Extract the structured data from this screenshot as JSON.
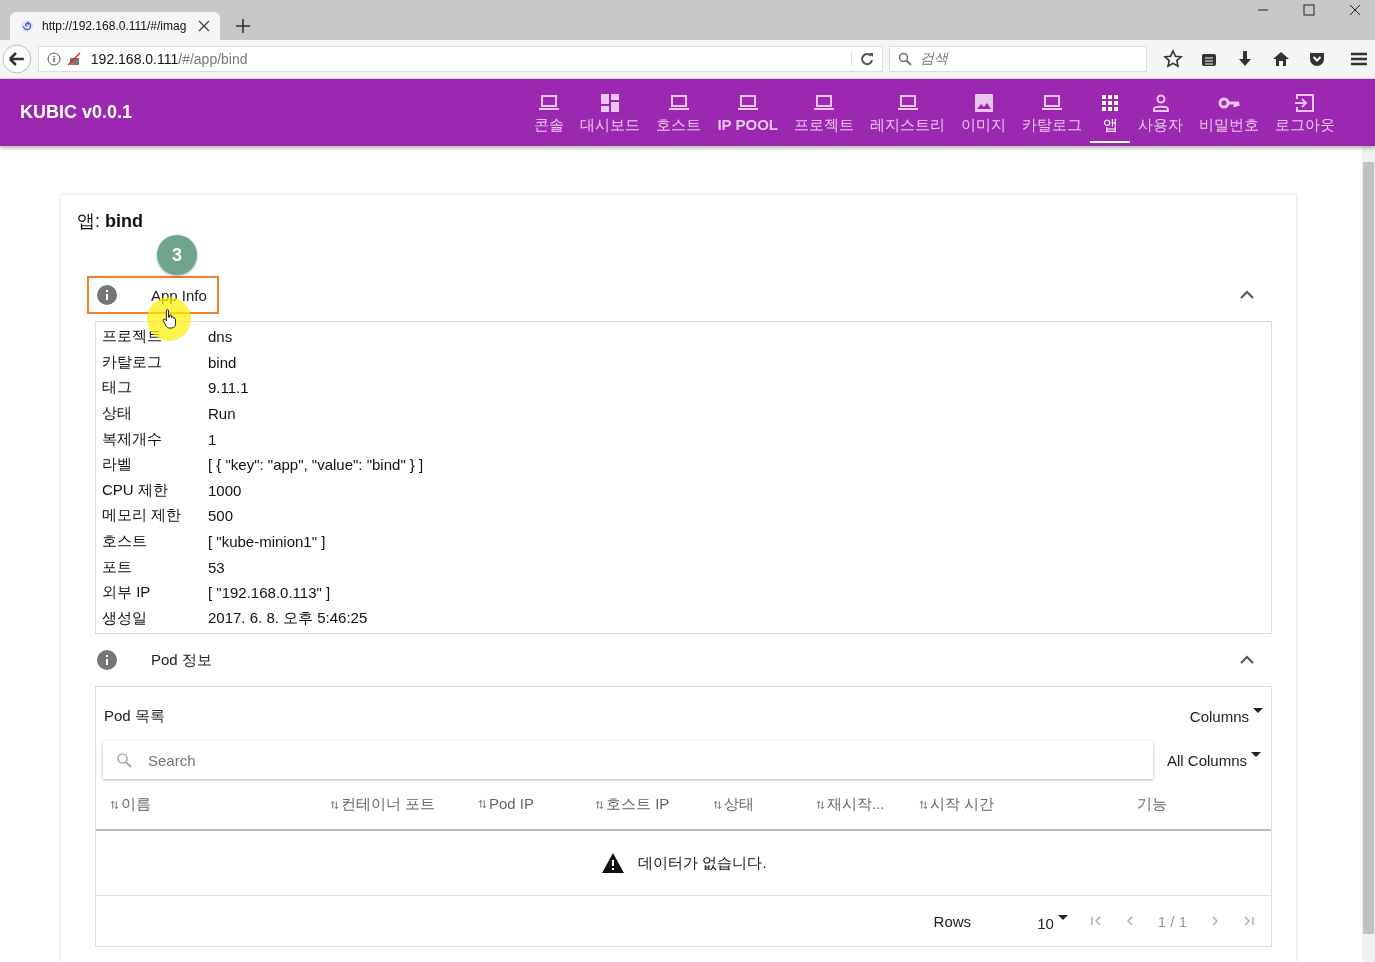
{
  "browser": {
    "tab_title": "http://192.168.0.111/#/imag",
    "url_host": "192.168.0.111",
    "url_path": "/#/app/bind",
    "search_placeholder": "검색"
  },
  "header": {
    "brand": "KUBIC v0.0.1",
    "nav": [
      {
        "label": "콘솔",
        "kind": "laptop",
        "selected": false
      },
      {
        "label": "대시보드",
        "kind": "dashboard",
        "selected": false
      },
      {
        "label": "호스트",
        "kind": "laptop",
        "selected": false
      },
      {
        "label": "IP POOL",
        "kind": "laptop",
        "selected": false
      },
      {
        "label": "프로젝트",
        "kind": "laptop",
        "selected": false
      },
      {
        "label": "레지스트리",
        "kind": "laptop",
        "selected": false
      },
      {
        "label": "이미지",
        "kind": "image",
        "selected": false
      },
      {
        "label": "카탈로그",
        "kind": "laptop",
        "selected": false
      },
      {
        "label": "앱",
        "kind": "apps",
        "selected": true
      },
      {
        "label": "사용자",
        "kind": "person",
        "selected": false
      },
      {
        "label": "비밀번호",
        "kind": "key",
        "selected": false
      },
      {
        "label": "로그아웃",
        "kind": "logout",
        "selected": false
      }
    ]
  },
  "page": {
    "title_prefix": "앱:",
    "title_name": "bind",
    "step_badge": "3",
    "app_info": {
      "title": "App Info",
      "expanded": true,
      "highlighted": true,
      "rows": [
        {
          "label": "프로젝트",
          "value": "dns"
        },
        {
          "label": "카탈로그",
          "value": "bind"
        },
        {
          "label": "태그",
          "value": "9.11.1"
        },
        {
          "label": "상태",
          "value": "Run"
        },
        {
          "label": "복제개수",
          "value": "1"
        },
        {
          "label": "라벨",
          "value": "[ { \"key\": \"app\", \"value\": \"bind\" } ]"
        },
        {
          "label": "CPU 제한",
          "value": "1000"
        },
        {
          "label": "메모리 제한",
          "value": "500"
        },
        {
          "label": "호스트",
          "value": "[ \"kube-minion1\" ]"
        },
        {
          "label": "포트",
          "value": "53"
        },
        {
          "label": "외부 IP",
          "value": "[ \"192.168.0.113\" ]"
        },
        {
          "label": "생성일",
          "value": "2017. 6. 8. 오후 5:46:25"
        }
      ]
    },
    "pod_info": {
      "title": "Pod 정보",
      "expanded": true,
      "list_title": "Pod 목록",
      "columns_button": "Columns",
      "search_placeholder": "Search",
      "filter": "All Columns",
      "columns": [
        {
          "label": "이름",
          "sortable": true
        },
        {
          "label": "컨테이너 포트",
          "sortable": true
        },
        {
          "label": "Pod IP",
          "sortable": true
        },
        {
          "label": "호스트 IP",
          "sortable": true
        },
        {
          "label": "상태",
          "sortable": true
        },
        {
          "label": "재시작...",
          "sortable": true
        },
        {
          "label": "시작 시간",
          "sortable": true
        },
        {
          "label": "기능",
          "sortable": false
        }
      ],
      "empty_message": "데이터가 없습니다.",
      "rows_label": "Rows",
      "rows_per_page": "10",
      "page_indicator": "1 / 1"
    }
  }
}
